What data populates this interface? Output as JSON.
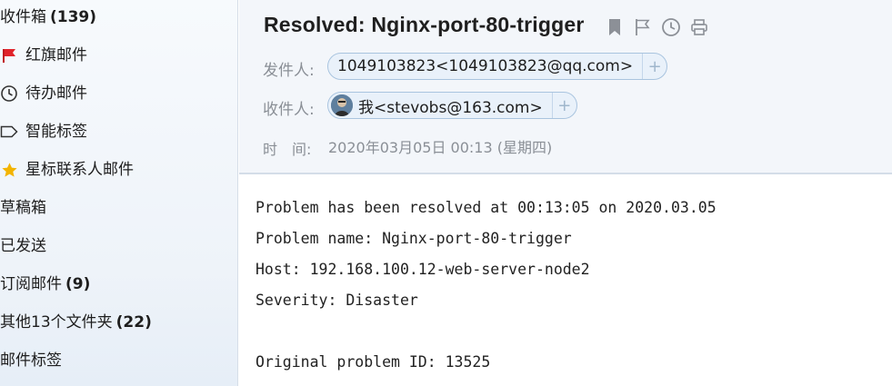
{
  "sidebar": {
    "items": [
      {
        "label": "收件箱",
        "count": "(139)"
      },
      {
        "label": "红旗邮件"
      },
      {
        "label": "待办邮件"
      },
      {
        "label": "智能标签"
      },
      {
        "label": "星标联系人邮件"
      },
      {
        "label": "草稿箱"
      },
      {
        "label": "已发送"
      },
      {
        "label": "订阅邮件",
        "count": "(9)"
      },
      {
        "label": "其他13个文件夹",
        "count": "(22)"
      },
      {
        "label": "邮件标签"
      }
    ]
  },
  "header": {
    "subject": "Resolved: Nginx-port-80-trigger",
    "icons": [
      "bookmark-icon",
      "flag-icon",
      "clock-icon",
      "print-icon"
    ],
    "from_label": "发件人:",
    "from_value": "1049103823<1049103823@qq.com>",
    "to_label": "收件人:",
    "to_value": "我<stevobs@163.com>",
    "time_label": "时　间:",
    "time_value": "2020年03月05日 00:13 (星期四)",
    "plus": "+"
  },
  "body": {
    "lines": [
      "Problem has been resolved at 00:13:05 on 2020.03.05",
      "Problem name: Nginx-port-80-trigger",
      "Host: 192.168.100.12-web-server-node2",
      "Severity: Disaster",
      "",
      "Original problem ID: 13525"
    ]
  },
  "colors": {
    "accent_border": "#a9c4df",
    "chip_bg": "#e9f1fa",
    "red_flag": "#e0232a",
    "star": "#f3b400"
  }
}
